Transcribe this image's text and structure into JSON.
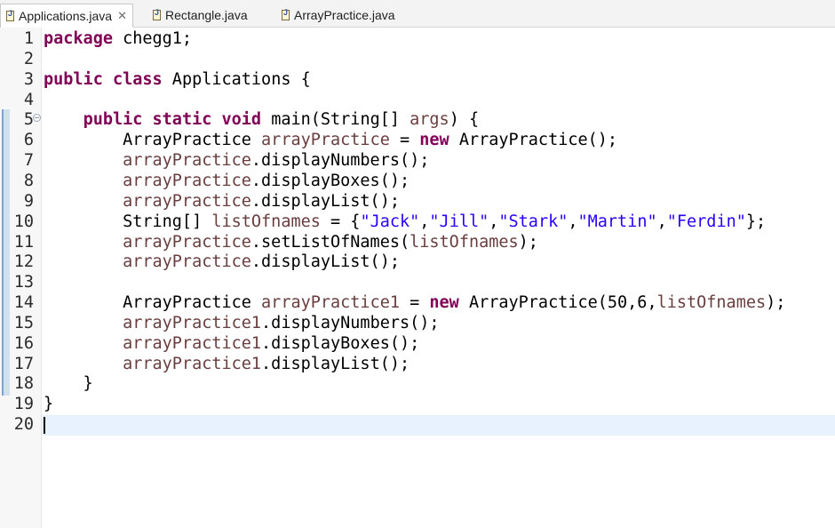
{
  "tabs": [
    {
      "label": "Applications.java",
      "active": true,
      "closable": true
    },
    {
      "label": "Rectangle.java",
      "active": false
    },
    {
      "label": "ArrayPractice.java",
      "active": false
    }
  ],
  "editor": {
    "lines": [
      {
        "n": "1",
        "tokens": [
          {
            "t": "kw",
            "v": "package"
          },
          {
            "t": "p",
            "v": " chegg1;"
          }
        ]
      },
      {
        "n": "2",
        "tokens": []
      },
      {
        "n": "3",
        "tokens": [
          {
            "t": "kw",
            "v": "public"
          },
          {
            "t": "p",
            "v": " "
          },
          {
            "t": "kw",
            "v": "class"
          },
          {
            "t": "p",
            "v": " Applications {"
          }
        ]
      },
      {
        "n": "4",
        "tokens": []
      },
      {
        "n": "5",
        "fold": true,
        "tokens": [
          {
            "t": "p",
            "v": "    "
          },
          {
            "t": "kw",
            "v": "public"
          },
          {
            "t": "p",
            "v": " "
          },
          {
            "t": "kw",
            "v": "static"
          },
          {
            "t": "p",
            "v": " "
          },
          {
            "t": "kw",
            "v": "void"
          },
          {
            "t": "p",
            "v": " main(String[] "
          },
          {
            "t": "fld",
            "v": "args"
          },
          {
            "t": "p",
            "v": ") {"
          }
        ]
      },
      {
        "n": "6",
        "tokens": [
          {
            "t": "p",
            "v": "        ArrayPractice "
          },
          {
            "t": "fld",
            "v": "arrayPractice"
          },
          {
            "t": "p",
            "v": " = "
          },
          {
            "t": "kw",
            "v": "new"
          },
          {
            "t": "p",
            "v": " ArrayPractice();"
          }
        ]
      },
      {
        "n": "7",
        "tokens": [
          {
            "t": "p",
            "v": "        "
          },
          {
            "t": "fld",
            "v": "arrayPractice"
          },
          {
            "t": "p",
            "v": ".displayNumbers();"
          }
        ]
      },
      {
        "n": "8",
        "tokens": [
          {
            "t": "p",
            "v": "        "
          },
          {
            "t": "fld",
            "v": "arrayPractice"
          },
          {
            "t": "p",
            "v": ".displayBoxes();"
          }
        ]
      },
      {
        "n": "9",
        "tokens": [
          {
            "t": "p",
            "v": "        "
          },
          {
            "t": "fld",
            "v": "arrayPractice"
          },
          {
            "t": "p",
            "v": ".displayList();"
          }
        ]
      },
      {
        "n": "10",
        "tokens": [
          {
            "t": "p",
            "v": "        String[] "
          },
          {
            "t": "fld",
            "v": "listOfnames"
          },
          {
            "t": "p",
            "v": " = {"
          },
          {
            "t": "str",
            "v": "\"Jack\""
          },
          {
            "t": "p",
            "v": ","
          },
          {
            "t": "str",
            "v": "\"Jill\""
          },
          {
            "t": "p",
            "v": ","
          },
          {
            "t": "str",
            "v": "\"Stark\""
          },
          {
            "t": "p",
            "v": ","
          },
          {
            "t": "str",
            "v": "\"Martin\""
          },
          {
            "t": "p",
            "v": ","
          },
          {
            "t": "str",
            "v": "\"Ferdin\""
          },
          {
            "t": "p",
            "v": "};"
          }
        ]
      },
      {
        "n": "11",
        "tokens": [
          {
            "t": "p",
            "v": "        "
          },
          {
            "t": "fld",
            "v": "arrayPractice"
          },
          {
            "t": "p",
            "v": ".setListOfNames("
          },
          {
            "t": "fld",
            "v": "listOfnames"
          },
          {
            "t": "p",
            "v": ");"
          }
        ]
      },
      {
        "n": "12",
        "tokens": [
          {
            "t": "p",
            "v": "        "
          },
          {
            "t": "fld",
            "v": "arrayPractice"
          },
          {
            "t": "p",
            "v": ".displayList();"
          }
        ]
      },
      {
        "n": "13",
        "tokens": []
      },
      {
        "n": "14",
        "tokens": [
          {
            "t": "p",
            "v": "        ArrayPractice "
          },
          {
            "t": "fld",
            "v": "arrayPractice1"
          },
          {
            "t": "p",
            "v": " = "
          },
          {
            "t": "kw",
            "v": "new"
          },
          {
            "t": "p",
            "v": " ArrayPractice(50,6,"
          },
          {
            "t": "fld",
            "v": "listOfnames"
          },
          {
            "t": "p",
            "v": ");"
          }
        ]
      },
      {
        "n": "15",
        "tokens": [
          {
            "t": "p",
            "v": "        "
          },
          {
            "t": "fld",
            "v": "arrayPractice1"
          },
          {
            "t": "p",
            "v": ".displayNumbers();"
          }
        ]
      },
      {
        "n": "16",
        "tokens": [
          {
            "t": "p",
            "v": "        "
          },
          {
            "t": "fld",
            "v": "arrayPractice1"
          },
          {
            "t": "p",
            "v": ".displayBoxes();"
          }
        ]
      },
      {
        "n": "17",
        "tokens": [
          {
            "t": "p",
            "v": "        "
          },
          {
            "t": "fld",
            "v": "arrayPractice1"
          },
          {
            "t": "p",
            "v": ".displayList();"
          }
        ]
      },
      {
        "n": "18",
        "tokens": [
          {
            "t": "p",
            "v": "    }"
          }
        ]
      },
      {
        "n": "19",
        "tokens": [
          {
            "t": "p",
            "v": "}"
          }
        ]
      },
      {
        "n": "20",
        "tokens": []
      }
    ],
    "current_line": "20"
  },
  "colors": {
    "keyword": "#7f0055",
    "variable": "#6a3e3e",
    "string": "#2a00ff",
    "current_line_bg": "#e8f2fe"
  }
}
